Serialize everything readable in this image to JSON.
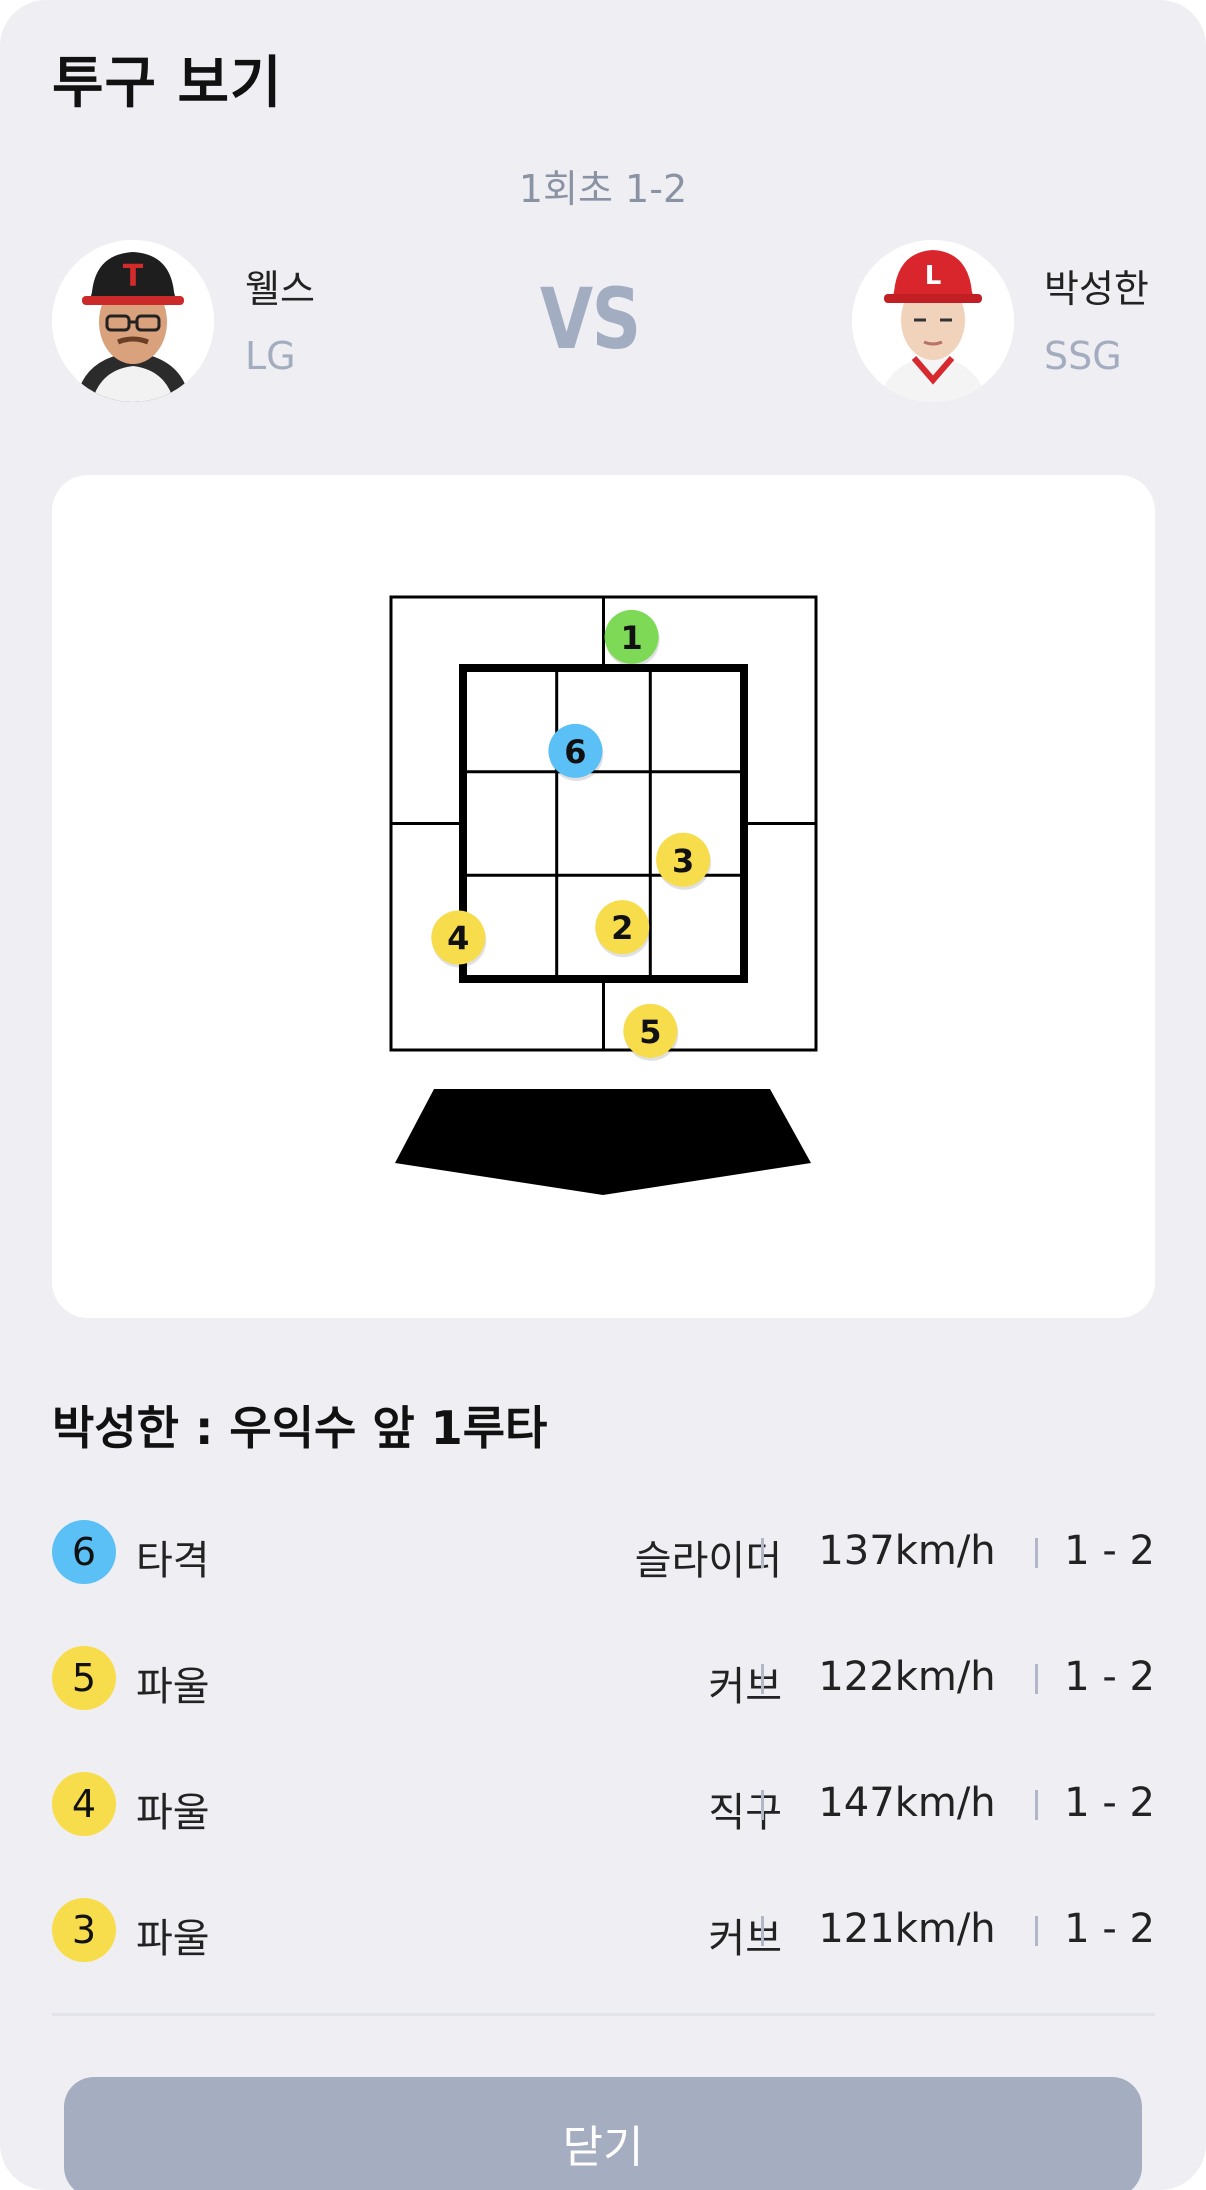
{
  "header": {
    "title": "투구 보기",
    "inning": "1회초 1-2",
    "vs_label": "VS"
  },
  "pitcher": {
    "name": "웰스",
    "team": "LG"
  },
  "batter": {
    "name": "박성한",
    "team": "SSG"
  },
  "strike_zone": {
    "markers": [
      {
        "number": "1",
        "color": "#7ed957",
        "col": 1.8,
        "row": -0.3
      },
      {
        "number": "2",
        "color": "#f7dc4b",
        "col": 1.7,
        "row": 2.5
      },
      {
        "number": "3",
        "color": "#f7dc4b",
        "col": 2.35,
        "row": 1.85
      },
      {
        "number": "4",
        "color": "#f7dc4b",
        "col": -0.05,
        "row": 2.6
      },
      {
        "number": "5",
        "color": "#f7dc4b",
        "col": 2.0,
        "row": 3.5
      },
      {
        "number": "6",
        "color": "#5bc0f5",
        "col": 1.2,
        "row": 0.8
      }
    ]
  },
  "at_bat_result": "박성한 : 우익수 앞 1루타",
  "pitches": [
    {
      "number": "6",
      "result": "타격",
      "type": "슬라이더",
      "speed": "137km/h",
      "count": "1 - 2",
      "color": "#5bc0f5"
    },
    {
      "number": "5",
      "result": "파울",
      "type": "커브",
      "speed": "122km/h",
      "count": "1 - 2",
      "color": "#f7dc4b"
    },
    {
      "number": "4",
      "result": "파울",
      "type": "직구",
      "speed": "147km/h",
      "count": "1 - 2",
      "color": "#f7dc4b"
    },
    {
      "number": "3",
      "result": "파울",
      "type": "커브",
      "speed": "121km/h",
      "count": "1 - 2",
      "color": "#f7dc4b"
    }
  ],
  "close_button": "닫기"
}
